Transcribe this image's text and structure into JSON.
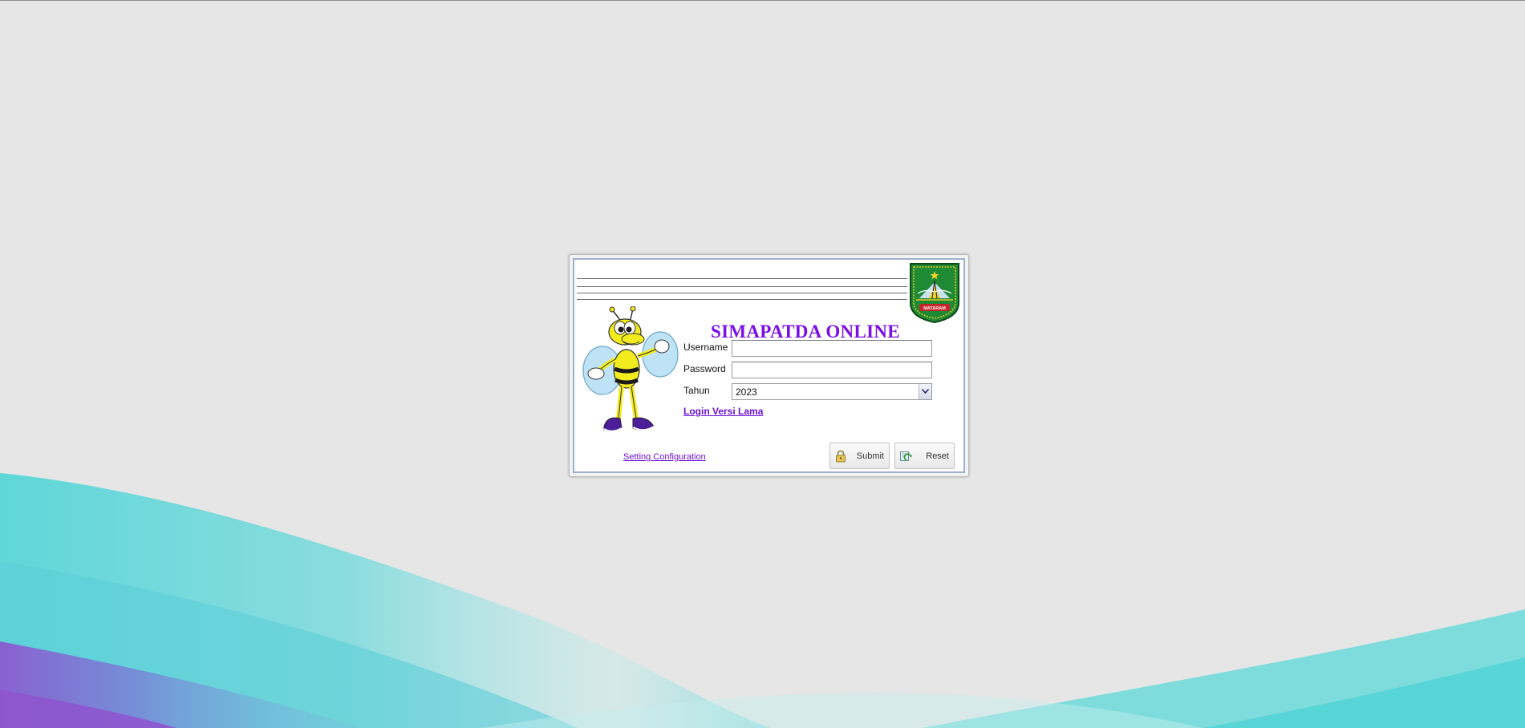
{
  "app": {
    "title": "SIMAPATDA ONLINE"
  },
  "logo": {
    "text": "MATARAM"
  },
  "form": {
    "username_label": "Username",
    "username_value": "",
    "password_label": "Password",
    "password_value": "",
    "year_label": "Tahun",
    "year_value": "2023"
  },
  "links": {
    "old_login": "Login Versi Lama",
    "setting": "Setting Configuration"
  },
  "buttons": {
    "submit": "Submit",
    "reset": "Reset"
  },
  "icons": {
    "submit": "lock-icon",
    "reset": "refresh-icon",
    "dropdown": "chevron-down-icon"
  },
  "colors": {
    "title": "#7a0fe6",
    "link": "#6a0fd6",
    "background": "#e6e6e6",
    "wave_cyan": "#3fd3d6",
    "wave_purple": "#8a57d0"
  }
}
